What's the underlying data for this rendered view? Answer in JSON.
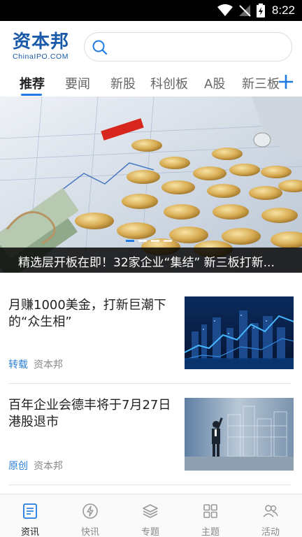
{
  "status_bar": {
    "time": "8:22"
  },
  "header": {
    "logo_cn": "资本邦",
    "logo_en": "ChinaIPO.COM",
    "search_placeholder": ""
  },
  "tabs": [
    {
      "label": "推荐",
      "active": true
    },
    {
      "label": "要闻"
    },
    {
      "label": "新股"
    },
    {
      "label": "科创板"
    },
    {
      "label": "A股"
    },
    {
      "label": "新三板"
    }
  ],
  "banner": {
    "caption": "精选层开板在即！32家企业“集结” 新三板打新...",
    "dots": 4,
    "active_dot": 0
  },
  "articles": [
    {
      "title": "月赚1000美金，打新巨潮下的“众生相”",
      "tag": "转载",
      "source": "资本邦"
    },
    {
      "title": "百年企业会德丰将于7月27日港股退市",
      "tag": "原创",
      "source": "资本邦"
    }
  ],
  "bottom_nav": [
    {
      "label": "资讯",
      "icon": "news-icon",
      "active": true
    },
    {
      "label": "快讯",
      "icon": "flash-icon"
    },
    {
      "label": "专题",
      "icon": "layers-icon"
    },
    {
      "label": "主题",
      "icon": "grid-icon"
    },
    {
      "label": "活动",
      "icon": "people-icon"
    }
  ],
  "colors": {
    "brand": "#1a5aa8",
    "accent": "#1f7be3",
    "tag": "#2b7fd9"
  }
}
